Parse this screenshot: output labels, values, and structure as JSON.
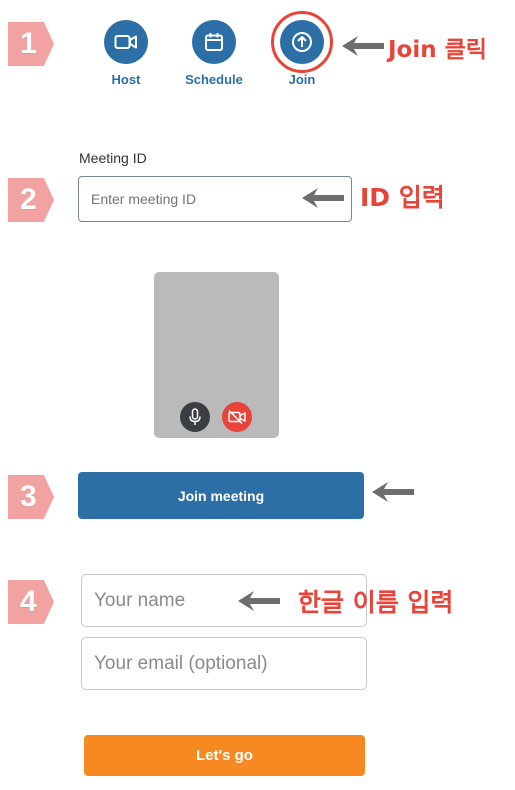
{
  "steps": [
    "1",
    "2",
    "3",
    "4"
  ],
  "nav": {
    "host_label": "Host",
    "schedule_label": "Schedule",
    "join_label": "Join",
    "icons": [
      "video-camera-icon",
      "calendar-icon",
      "arrow-up-circle-icon"
    ],
    "accent": "#2b6fa6"
  },
  "annotations": {
    "join_click": "Join 클릭",
    "id_input": "ID 입력",
    "name_input": "한글 이름 입력",
    "color": "#e8443a"
  },
  "meeting": {
    "label": "Meeting ID",
    "placeholder": "Enter meeting ID"
  },
  "preview": {
    "icons": [
      "microphone-icon",
      "video-off-icon"
    ]
  },
  "join_meeting_label": "Join meeting",
  "form": {
    "name_placeholder": "Your name",
    "email_placeholder": "Your email (optional)"
  },
  "lets_go_label": "Let's go",
  "lets_go_color": "#f6891f"
}
